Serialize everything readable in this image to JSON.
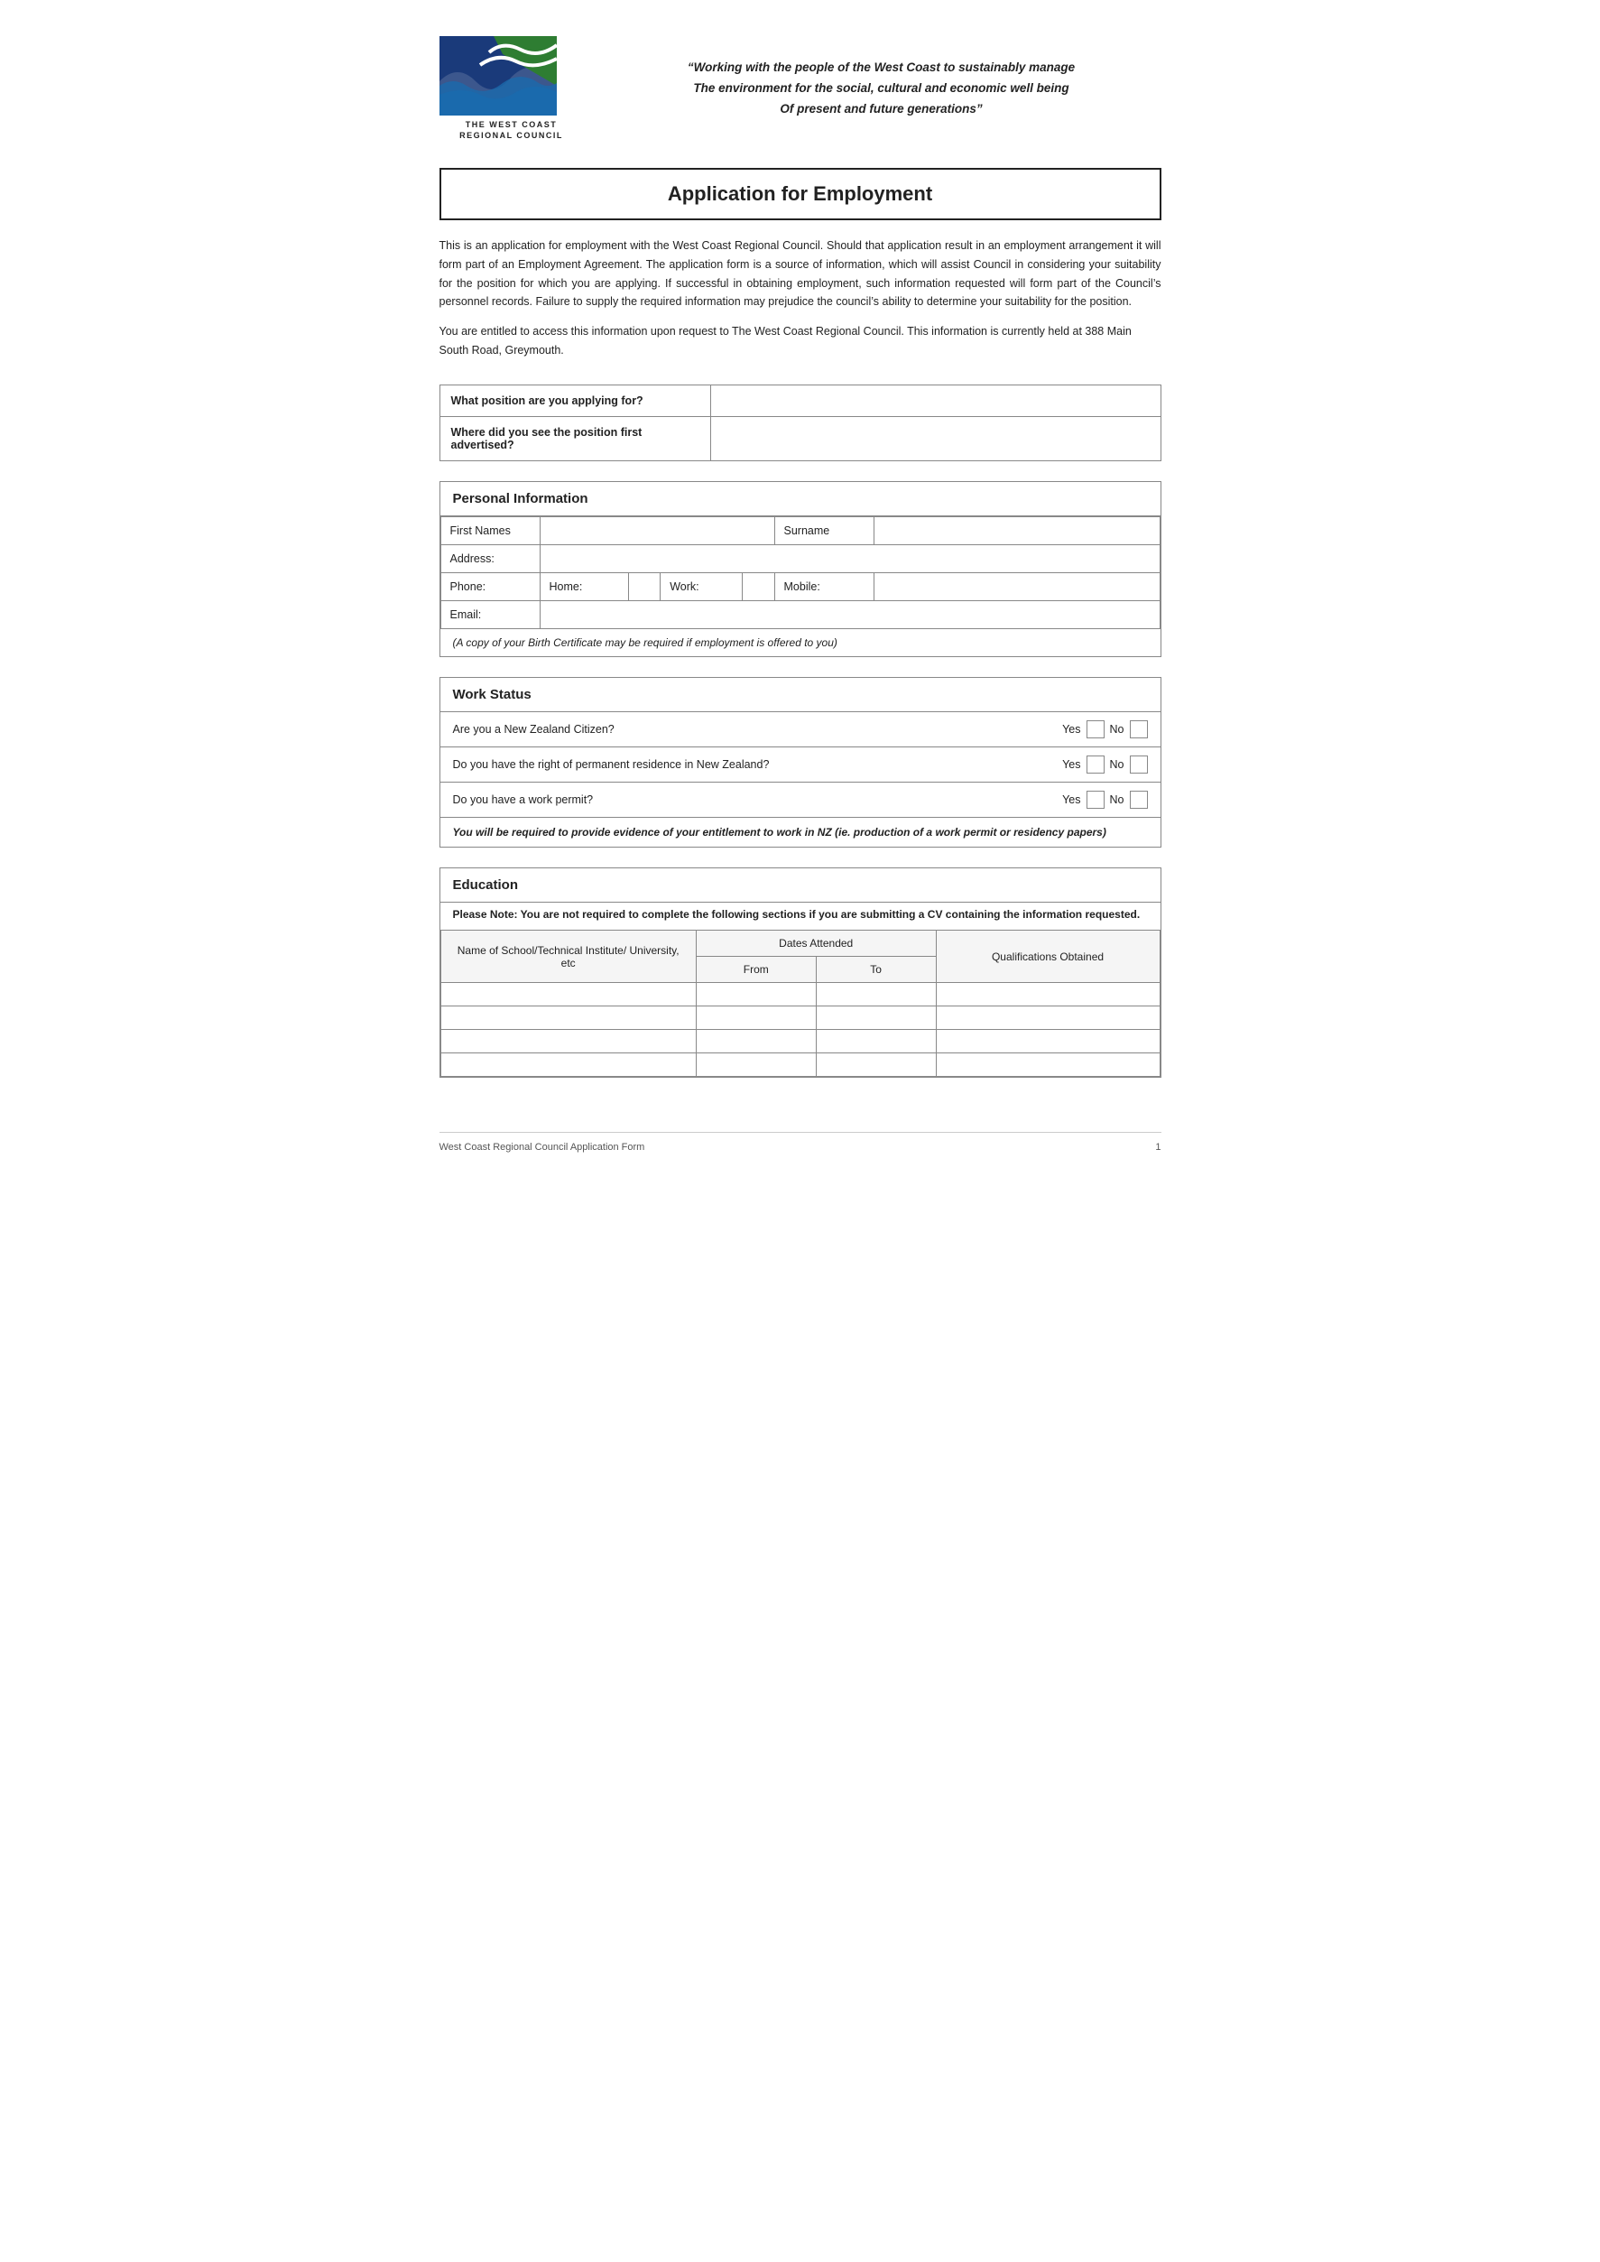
{
  "header": {
    "tagline_line1": "“Working with the people of the West Coast to sustainably manage",
    "tagline_line2": "The environment for the social, cultural and economic well being",
    "tagline_line3": "Of present and future generations”",
    "logo_name_line1": "THE WEST COAST",
    "logo_name_line2": "REGIONAL COUNCIL"
  },
  "page_title": "Application for Employment",
  "intro": {
    "para1": "This is an application for employment with the West Coast Regional Council.  Should that application result in an employment arrangement it will form part of an Employment Agreement.  The application form is a source of information, which will assist Council in considering your suitability for the position for which you are applying.  If successful in obtaining employment, such information requested will form part of the Council’s personnel records.  Failure to supply the required information may prejudice the council’s ability to determine your suitability for the position.",
    "para2": "You are entitled to access this information upon request to The West Coast Regional Council.  This information is currently held at 388 Main South Road, Greymouth."
  },
  "position_section": {
    "question1_label": "What position are you applying for?",
    "question1_value": "",
    "question2_label": "Where did you see the position first advertised?",
    "question2_value": ""
  },
  "personal_info": {
    "section_title": "Personal Information",
    "first_names_label": "First Names",
    "first_names_value": "",
    "surname_label": "Surname",
    "surname_value": "",
    "address_label": "Address:",
    "address_value": "",
    "phone_label": "Phone:",
    "home_label": "Home:",
    "home_value": "",
    "work_label": "Work:",
    "work_value": "",
    "mobile_label": "Mobile:",
    "mobile_value": "",
    "email_label": "Email:",
    "email_value": "",
    "birth_notice": "(A copy of your Birth Certificate may be required if employment is offered to you)"
  },
  "work_status": {
    "section_title": "Work Status",
    "rows": [
      {
        "question": "Are you a New Zealand Citizen?",
        "yes_label": "Yes",
        "no_label": "No"
      },
      {
        "question": "Do you have the right of permanent residence in New Zealand?",
        "yes_label": "Yes",
        "no_label": "No"
      },
      {
        "question": "Do you have a work permit?",
        "yes_label": "Yes",
        "no_label": "No"
      }
    ],
    "notice": "You will be required to provide evidence of your entitlement to work in NZ (ie. production of a work permit or residency papers)"
  },
  "education": {
    "section_title": "Education",
    "note": "Please Note: You are not required to complete the following sections if you are submitting a CV containing the information requested.",
    "table_headers": {
      "institution": "Name of School/Technical Institute/ University, etc",
      "dates_attended": "Dates Attended",
      "from": "From",
      "to": "To",
      "qualifications": "Qualifications Obtained"
    },
    "rows": [
      {
        "institution": "",
        "from": "",
        "to": "",
        "qualifications": ""
      },
      {
        "institution": "",
        "from": "",
        "to": "",
        "qualifications": ""
      },
      {
        "institution": "",
        "from": "",
        "to": "",
        "qualifications": ""
      },
      {
        "institution": "",
        "from": "",
        "to": "",
        "qualifications": ""
      }
    ]
  },
  "footer": {
    "left": "West Coast Regional Council Application Form",
    "right": "1"
  }
}
